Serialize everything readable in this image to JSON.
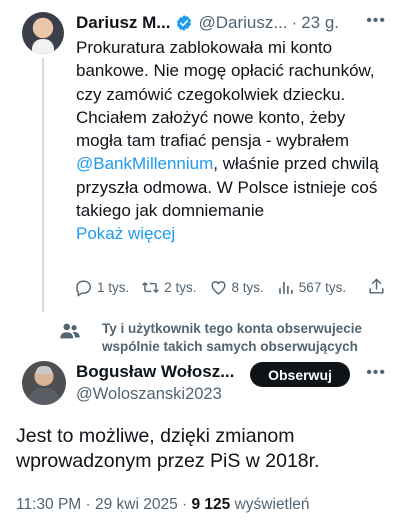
{
  "tweet1": {
    "name": "Dariusz M...",
    "handle": "@Dariusz...",
    "time": "23 g.",
    "body_text": "Prokuratura zablokowała mi konto bankowe. Nie mogę opłacić rachunków, czy zamówić czegokolwiek dziecku. Chciałem założyć nowe konto, żeby mogła tam trafiać pensja - wybrałem ",
    "mention": "@BankMillennium",
    "body_text_2": ", właśnie przed chwilą przyszła odmowa. W Polsce istnieje coś takiego jak domniemanie",
    "show_more": "Pokaż więcej",
    "replies": "1 tys.",
    "reposts": "2 tys.",
    "likes": "8 tys.",
    "views": "567 tys."
  },
  "mutual_follow_text": "Ty i użytkownik tego konta obserwujecie wspólnie takich samych obserwujących",
  "tweet2": {
    "name": "Bogusław Wołosz...",
    "handle": "@Woloszanski2023",
    "follow_label": "Obserwuj",
    "body": "Jest to możliwe, dzięki zmianom wprowadzonym przez PiS w 2018r.",
    "time": "11:30 PM",
    "date": "29 kwi 2025",
    "views_count": "9 125",
    "views_label": "wyświetleń"
  },
  "colors": {
    "accent": "#1d9bf0",
    "text": "#0f1419",
    "secondary": "#536471",
    "follow_button_bg": "#0f1419"
  },
  "icons": [
    "verified-badge-icon",
    "more-icon",
    "reply-icon",
    "repost-icon",
    "like-icon",
    "views-icon",
    "share-icon",
    "mutual-followers-icon"
  ]
}
